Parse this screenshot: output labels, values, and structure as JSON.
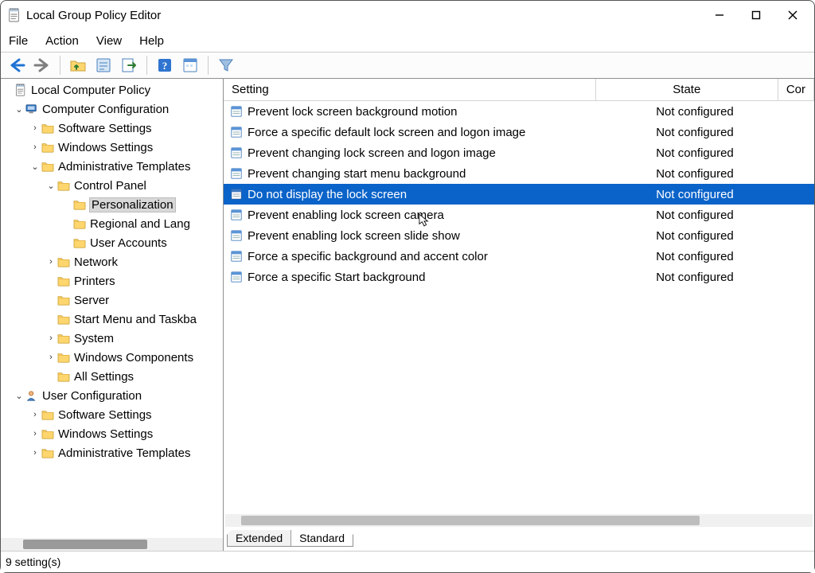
{
  "window": {
    "title": "Local Group Policy Editor"
  },
  "menu": {
    "file": "File",
    "action": "Action",
    "view": "View",
    "help": "Help"
  },
  "tree": {
    "root": {
      "label": "Local Computer Policy"
    },
    "comp_cfg": {
      "label": "Computer Configuration"
    },
    "cc_sw": {
      "label": "Software Settings"
    },
    "cc_win": {
      "label": "Windows Settings"
    },
    "cc_admin": {
      "label": "Administrative Templates"
    },
    "cp": {
      "label": "Control Panel"
    },
    "pers": {
      "label": "Personalization"
    },
    "reg": {
      "label": "Regional and Lang"
    },
    "ua": {
      "label": "User Accounts"
    },
    "net": {
      "label": "Network"
    },
    "prn": {
      "label": "Printers"
    },
    "srv": {
      "label": "Server"
    },
    "start": {
      "label": "Start Menu and Taskba"
    },
    "sys": {
      "label": "System"
    },
    "wincomp": {
      "label": "Windows Components"
    },
    "allset": {
      "label": "All Settings"
    },
    "user_cfg": {
      "label": "User Configuration"
    },
    "uc_sw": {
      "label": "Software Settings"
    },
    "uc_win": {
      "label": "Windows Settings"
    },
    "uc_admin": {
      "label": "Administrative Templates"
    }
  },
  "list": {
    "headers": {
      "setting": "Setting",
      "state": "State",
      "comment": "Cor"
    },
    "rows": [
      {
        "setting": "Prevent lock screen background motion",
        "state": "Not configured"
      },
      {
        "setting": "Force a specific default lock screen and logon image",
        "state": "Not configured"
      },
      {
        "setting": "Prevent changing lock screen and logon image",
        "state": "Not configured"
      },
      {
        "setting": "Prevent changing start menu background",
        "state": "Not configured"
      },
      {
        "setting": "Do not display the lock screen",
        "state": "Not configured"
      },
      {
        "setting": "Prevent enabling lock screen camera",
        "state": "Not configured"
      },
      {
        "setting": "Prevent enabling lock screen slide show",
        "state": "Not configured"
      },
      {
        "setting": "Force a specific background and accent color",
        "state": "Not configured"
      },
      {
        "setting": "Force a specific Start background",
        "state": "Not configured"
      }
    ],
    "selected_index": 4
  },
  "tabs": {
    "extended": "Extended",
    "standard": "Standard"
  },
  "status": {
    "text": "9 setting(s)"
  }
}
